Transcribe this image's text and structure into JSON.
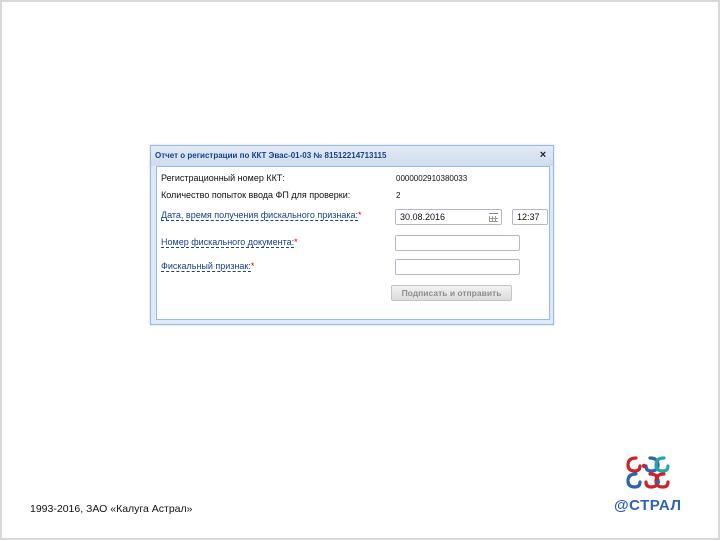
{
  "dialog": {
    "title": "Отчет о регистрации по ККТ Эвас-01-03 № 81512214713115",
    "close_symbol": "×",
    "reg_number_label": "Регистрационный номер ККТ:",
    "reg_number_value": "0000002910380033",
    "attempts_label": "Количество попыток ввода ФП для проверки:",
    "attempts_value": "2",
    "datetime_label": "Дата, время получения фискального признака:",
    "date_value": "30.08.2016",
    "time_value": "12:37",
    "doc_number_label": "Номер фискального документа:",
    "fiscal_sign_label": "Фискальный признак:",
    "required_mark": "*",
    "submit_label": "Подписать и отправить"
  },
  "footer": {
    "copyright": "1993-2016, ЗАО «Калуга Астрал»"
  },
  "logo": {
    "wordmark": "@СТРАЛ",
    "colors": {
      "red": "#c8262c",
      "blue": "#2d63b0",
      "teal": "#2aa6a0"
    }
  }
}
